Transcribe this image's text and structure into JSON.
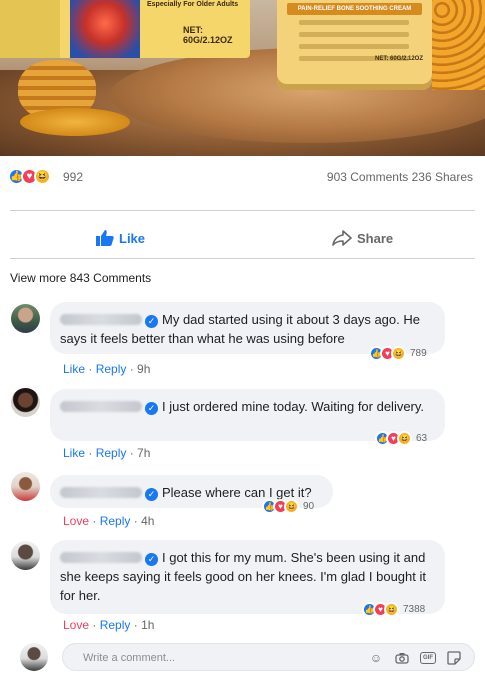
{
  "banner": {
    "box_tagline": "Especially For Older Adults",
    "box_net": "NET: 60G/2.12OZ",
    "jar_band": "PAIN-RELIEF BONE SOOTHING CREAM",
    "jar_net": "NET: 60G/2.12OZ"
  },
  "post": {
    "reaction_count": "992",
    "comments_shares": "903 Comments 236 Shares",
    "like_label": "Like",
    "share_label": "Share",
    "view_more": "View more 843 Comments"
  },
  "comments": [
    {
      "text": "My dad started using it about 3 days ago. He says it feels better than what he was using before",
      "action1": "Like",
      "reply": "Reply",
      "time": "9h",
      "react_count": "789"
    },
    {
      "text": "I just ordered mine today. Waiting for delivery.",
      "action1": "Like",
      "reply": "Reply",
      "time": "7h",
      "react_count": "63"
    },
    {
      "text": "Please where can I get it?",
      "action1": "Love",
      "reply": "Reply",
      "time": "4h",
      "react_count": "90"
    },
    {
      "text": "I got this for my mum. She's been using it and she keeps saying it feels good on her knees. I'm glad I bought it for her.",
      "action1": "Love",
      "reply": "Reply",
      "time": "1h",
      "react_count": "7388"
    }
  ],
  "composer": {
    "placeholder": "Write a comment..."
  },
  "colors": {
    "facebook_blue": "#1877f2",
    "love_red": "#f33e58",
    "haha_yellow": "#f7b125",
    "bubble_gray": "#f0f2f5"
  },
  "icons": {
    "like": "thumbs-up-icon",
    "love": "heart-icon",
    "haha": "laughing-face-icon",
    "share": "share-arrow-icon",
    "verified": "verified-badge-icon",
    "emoji": "emoji-icon",
    "camera": "camera-icon",
    "gif": "gif-icon",
    "sticker": "sticker-icon"
  }
}
